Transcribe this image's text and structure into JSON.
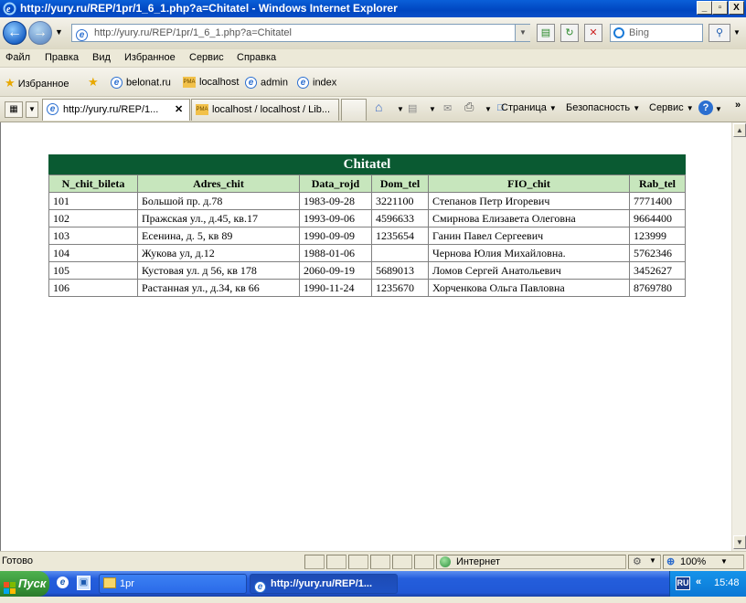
{
  "window": {
    "title": "http://yury.ru/REP/1pr/1_6_1.php?a=Chitatel - Windows Internet Explorer",
    "controls": [
      "_",
      "▫",
      "X"
    ]
  },
  "address": {
    "url": "http://yury.ru/REP/1pr/1_6_1.php?a=Chitatel",
    "search_placeholder": "Bing"
  },
  "menu": [
    "Файл",
    "Правка",
    "Вид",
    "Избранное",
    "Сервис",
    "Справка"
  ],
  "favorites": {
    "label": "Избранное",
    "links": [
      "belonat.ru",
      "localhost",
      "admin",
      "index"
    ]
  },
  "tabs": [
    {
      "label": "http://yury.ru/REP/1...",
      "active": true
    },
    {
      "label": "localhost / localhost / Lib...",
      "active": false
    }
  ],
  "commands": [
    "Страница",
    "Безопасность",
    "Сервис"
  ],
  "table": {
    "caption": "Chitatel",
    "headers": [
      "N_chit_bileta",
      "Adres_chit",
      "Data_rojd",
      "Dom_tel",
      "FIO_chit",
      "Rab_tel"
    ],
    "rows": [
      [
        "101",
        "Большой пр. д.78",
        "1983-09-28",
        "3221100",
        "Степанов Петр Игоревич",
        "7771400"
      ],
      [
        "102",
        "Пражская ул., д.45, кв.17",
        "1993-09-06",
        "4596633",
        "Смирнова Елизавета Олеговна",
        "9664400"
      ],
      [
        "103",
        "Есенина, д. 5, кв 89",
        "1990-09-09",
        "1235654",
        "Ганин Павел Сергеевич",
        "123999"
      ],
      [
        "104",
        "Жукова ул, д.12",
        "1988-01-06",
        "",
        "Чернова Юлия Михайловна.",
        "5762346"
      ],
      [
        "105",
        "Кустовая ул. д 56, кв 178",
        "2060-09-19",
        "5689013",
        "Ломов Сергей Анатольевич",
        "3452627"
      ],
      [
        "106",
        "Растанная ул., д.34, кв 66",
        "1990-11-24",
        "1235670",
        "Хорченкова Ольга Павловна",
        "8769780"
      ]
    ]
  },
  "status": {
    "text": "Готово",
    "zone": "Интернет",
    "zoom": "100%"
  },
  "taskbar": {
    "start": "Пуск",
    "items": [
      {
        "label": "1pr",
        "active": false
      },
      {
        "label": "http://yury.ru/REP/1...",
        "active": true
      }
    ],
    "lang": "RU",
    "clock": "15:48"
  },
  "colors": {
    "caption_bg": "#0a5a32",
    "header_bg": "#c7e6bd",
    "titlebar": "#0046c0"
  }
}
